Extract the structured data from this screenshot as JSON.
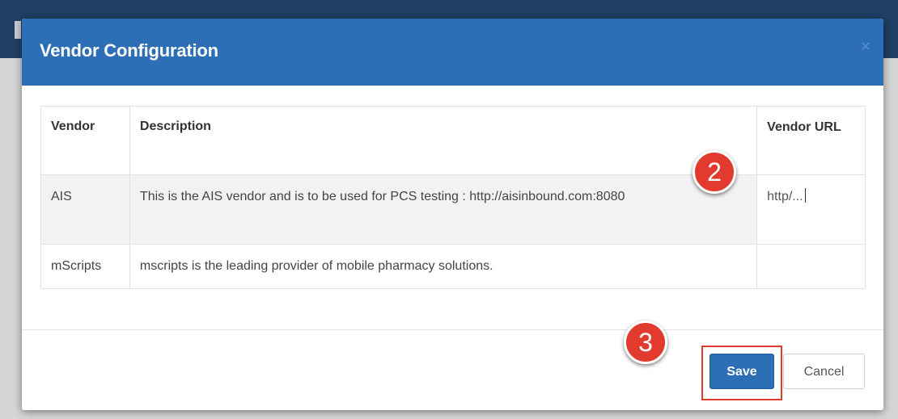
{
  "dialog": {
    "title": "Vendor Configuration",
    "close_icon": "close-icon"
  },
  "table": {
    "headers": [
      "Vendor",
      "Description",
      "Vendor URL"
    ],
    "rows": [
      {
        "vendor": "AIS",
        "description": "This is the AIS vendor and is to be used for PCS testing : http://aisinbound.com:8080",
        "url": "http/..."
      },
      {
        "vendor": "mScripts",
        "description": "mscripts is the leading provider of mobile pharmacy solutions.",
        "url": ""
      }
    ]
  },
  "annotations": {
    "step_2": "2",
    "step_3": "3",
    "badge_color": "#e23a2e"
  },
  "footer": {
    "save_label": "Save",
    "cancel_label": "Cancel"
  },
  "colors": {
    "header_blue": "#2d6fb6",
    "primary_button": "#2d6fb6"
  }
}
